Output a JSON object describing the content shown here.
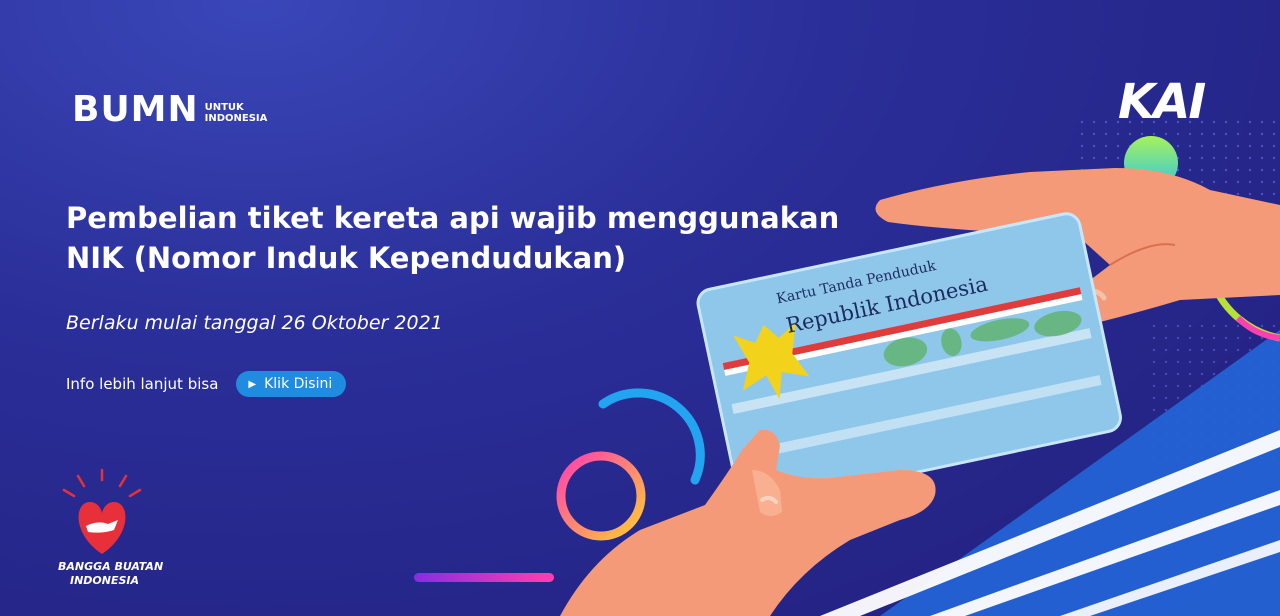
{
  "brand": {
    "bumn_word": "BUMN",
    "bumn_sub_line1": "UNTUK",
    "bumn_sub_line2": "INDONESIA",
    "kai_logo": "KAI",
    "bangga_line1": "BANGGA BUATAN",
    "bangga_line2": "INDONESIA"
  },
  "headline": {
    "line1": "Pembelian tiket kereta api wajib menggunakan",
    "line2": "NIK (Nomor Induk Kependudukan)"
  },
  "subtitle": "Berlaku mulai tanggal 26 Oktober 2021",
  "cta": {
    "text": "Info lebih lanjut bisa",
    "button_label": "Klik Disini",
    "button_color": "#1f8ce0"
  },
  "card": {
    "title_small": "Kartu Tanda Penduduk",
    "title_large": "Republik Indonesia"
  },
  "colors": {
    "background_dark": "#221f7d",
    "background_light": "#3a47b8",
    "skin": "#f59a78",
    "card": "#8fc7ea"
  }
}
